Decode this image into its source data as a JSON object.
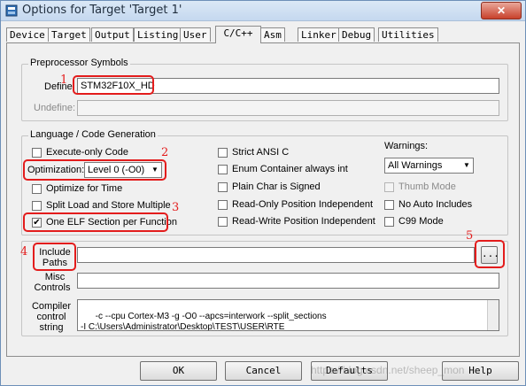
{
  "window": {
    "title": "Options for Target 'Target 1'",
    "close_label": "✕"
  },
  "tabs": [
    "Device",
    "Target",
    "Output",
    "Listing",
    "User",
    "C/C++",
    "Asm",
    "Linker",
    "Debug",
    "Utilities"
  ],
  "preprocessor": {
    "group_title": "Preprocessor Symbols",
    "define_label": "Define:",
    "define_value": "STM32F10X_HD",
    "undefine_label": "Undefine:",
    "undefine_value": ""
  },
  "language": {
    "group_title": "Language / Code Generation",
    "execute_only": "Execute-only Code",
    "optimization_label": "Optimization:",
    "optimization_value": "Level 0 (-O0)",
    "optimize_time": "Optimize for Time",
    "split_load": "Split Load and Store Multiple",
    "one_elf": "One ELF Section per Function",
    "strict_ansi": "Strict ANSI C",
    "enum_container": "Enum Container always int",
    "plain_char": "Plain Char is Signed",
    "ro_pi": "Read-Only Position Independent",
    "rw_pi": "Read-Write Position Independent",
    "warnings_label": "Warnings:",
    "warnings_value": "All Warnings",
    "thumb_mode": "Thumb Mode",
    "no_auto_includes": "No Auto Includes",
    "c99_mode": "C99 Mode",
    "check_mark": "✔"
  },
  "include": {
    "include_label_1": "Include",
    "include_label_2": "Paths",
    "browse_label": "...",
    "misc_label_1": "Misc",
    "misc_label_2": "Controls",
    "compiler_label_1": "Compiler",
    "compiler_label_2": "control",
    "compiler_label_3": "string",
    "compiler_string": "-c --cpu Cortex-M3 -g -O0 --apcs=interwork --split_sections\n-I C:\\Users\\Administrator\\Desktop\\TEST\\USER\\RTE"
  },
  "annotations": [
    "1",
    "2",
    "3",
    "4",
    "5"
  ],
  "buttons": {
    "ok": "OK",
    "cancel": "Cancel",
    "defaults": "Defaults",
    "help": "Help"
  },
  "watermark": "https://blog.csdn.net/sheep_mon",
  "colors": {
    "highlight": "#e31c1c",
    "title_bar": "#c5d8ef"
  }
}
